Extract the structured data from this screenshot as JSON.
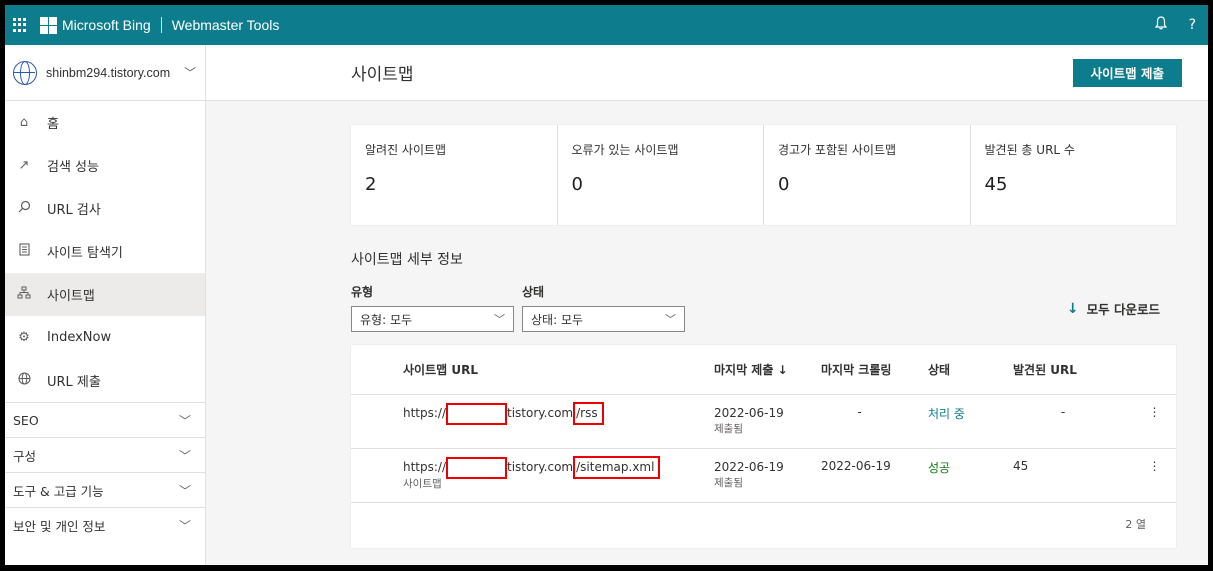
{
  "header": {
    "brand": "Microsoft Bing",
    "product": "Webmaster Tools",
    "icons": [
      "waffle-icon",
      "microsoft-logo",
      "bell-icon",
      "help-icon"
    ]
  },
  "sidebar": {
    "site": "shinbm294.tistory.com",
    "items": [
      {
        "label": "홈",
        "icon": "home-icon"
      },
      {
        "label": "검색 성능",
        "icon": "trend-icon"
      },
      {
        "label": "URL 검사",
        "icon": "search-icon"
      },
      {
        "label": "사이트 탐색기",
        "icon": "document-icon"
      },
      {
        "label": "사이트맵",
        "icon": "sitemap-icon",
        "active": true
      },
      {
        "label": "IndexNow",
        "icon": "gear-icon"
      },
      {
        "label": "URL 제출",
        "icon": "globe-icon"
      }
    ],
    "groups": [
      "SEO",
      "구성",
      "도구 & 고급 기능",
      "보안 및 개인 정보"
    ]
  },
  "page": {
    "title": "사이트맵",
    "submit_button": "사이트맵 제출"
  },
  "stats": [
    {
      "label": "알려진 사이트맵",
      "value": "2"
    },
    {
      "label": "오류가 있는 사이트맵",
      "value": "0"
    },
    {
      "label": "경고가 포함된 사이트맵",
      "value": "0"
    },
    {
      "label": "발견된 총 URL 수",
      "value": "45"
    }
  ],
  "details": {
    "title": "사이트맵 세부 정보",
    "filter_type_label": "유형",
    "filter_type_value": "유형: 모두",
    "filter_status_label": "상태",
    "filter_status_value": "상태: 모두",
    "download_all": "모두 다운로드"
  },
  "table": {
    "columns": [
      "사이트맵 URL",
      "마지막 제출 ↓",
      "마지막 크롤링",
      "상태",
      "발견된 URL"
    ],
    "rows": [
      {
        "url_prefix": "https://",
        "url_domain": "tistory.com",
        "url_path": "/rss",
        "url_type": "",
        "last_submitted": "2022-06-19",
        "submitted_note": "제출됨",
        "last_crawled": "-",
        "status": "처리 중",
        "status_color": "#0d7c8c",
        "found": "-"
      },
      {
        "url_prefix": "https://",
        "url_domain": "tistory.com",
        "url_path": "/sitemap.xml",
        "url_type": "사이트맵",
        "last_submitted": "2022-06-19",
        "submitted_note": "제출됨",
        "last_crawled": "2022-06-19",
        "status": "성공",
        "status_color": "#107c10",
        "found": "45"
      }
    ],
    "row_count": "2 열"
  },
  "colors": {
    "accent": "#0d7c8c",
    "success": "#107c10"
  }
}
